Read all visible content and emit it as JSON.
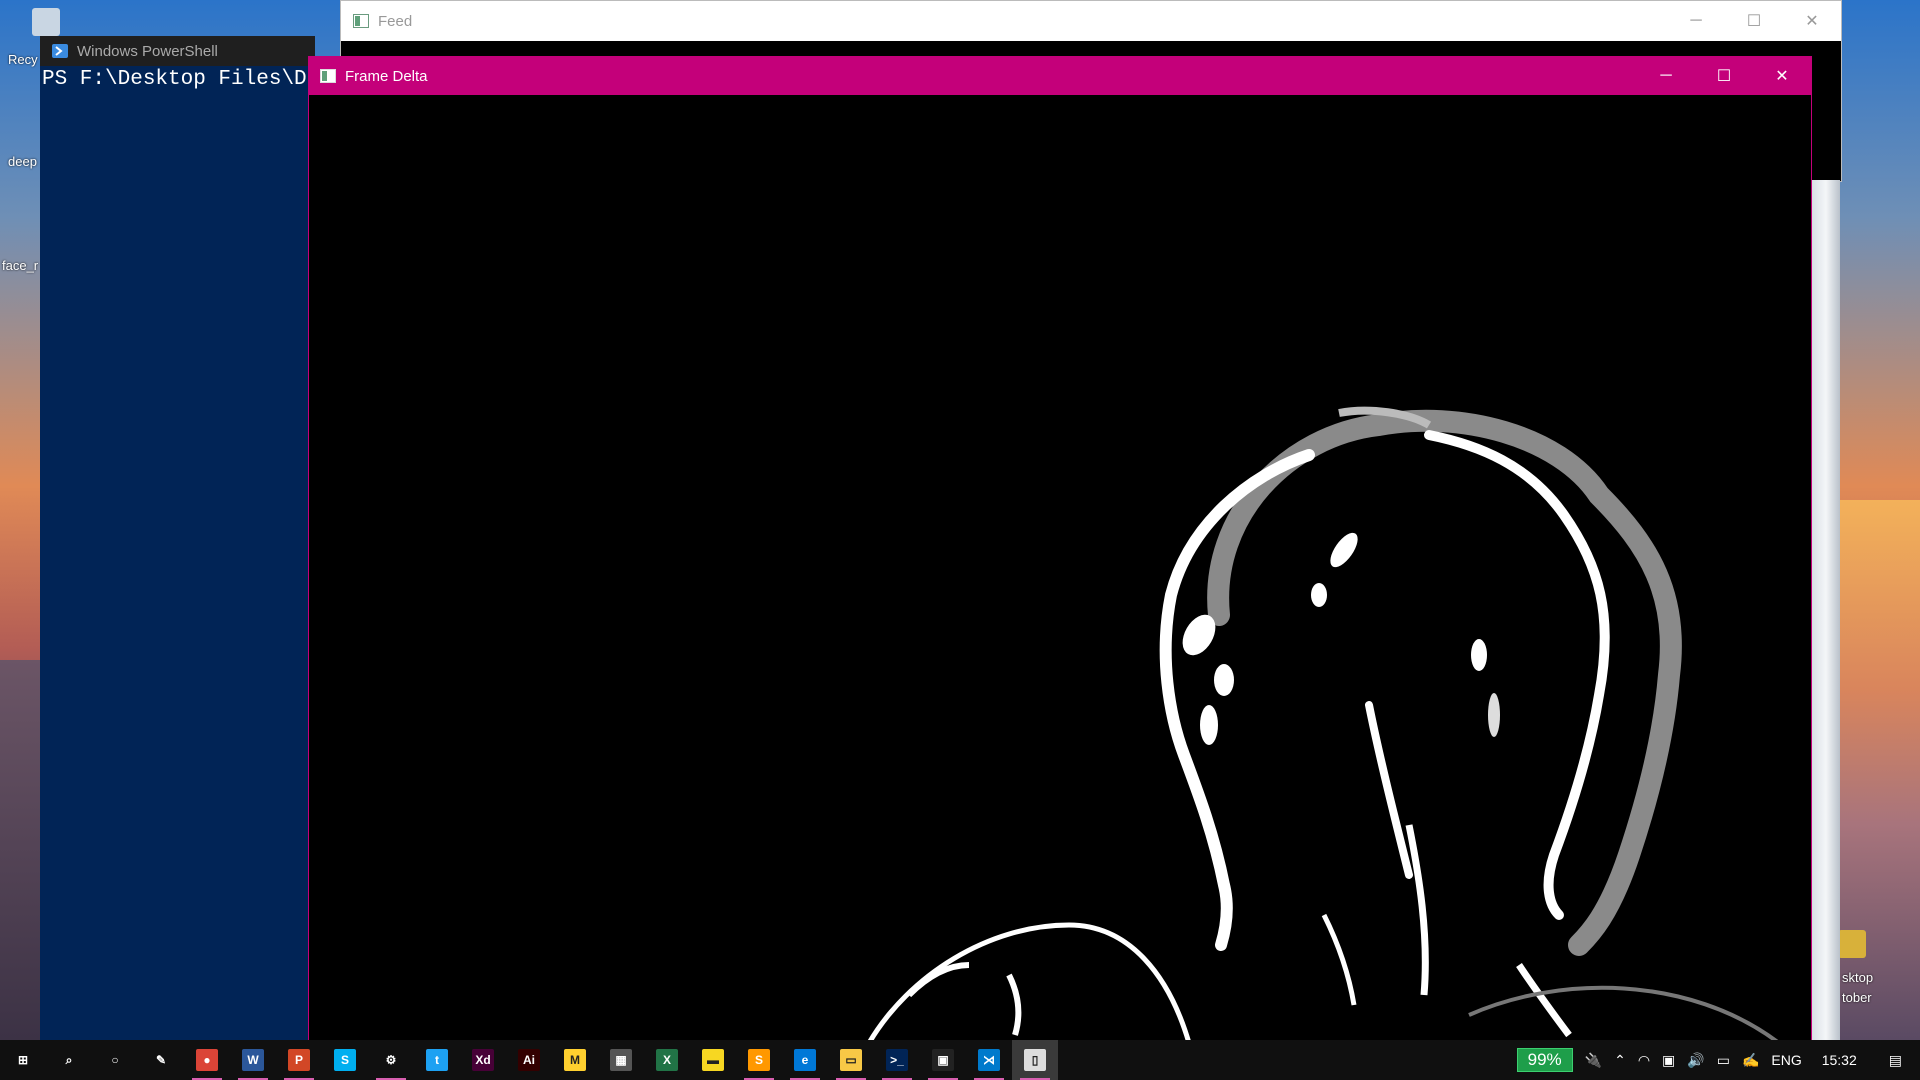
{
  "desktop": {
    "icons_left": [
      "Recy",
      "deep",
      "face_r"
    ],
    "icon_right_label_1": "sktop",
    "icon_right_label_2": "tober"
  },
  "feed_window": {
    "title": "Feed",
    "minimize": "─",
    "maximize": "☐",
    "close": "✕"
  },
  "powershell_window": {
    "title": "Windows PowerShell",
    "console_line": "PS F:\\Desktop Files\\Dra"
  },
  "frame_delta_window": {
    "title": "Frame Delta",
    "minimize": "─",
    "maximize": "☐",
    "close": "✕",
    "accent_color": "#c4007a"
  },
  "taskbar": {
    "apps": [
      {
        "name": "start",
        "icon": "windows-icon",
        "glyph": "⊞",
        "color": "#101010"
      },
      {
        "name": "search",
        "icon": "search-icon",
        "glyph": "⌕",
        "color": "#101010"
      },
      {
        "name": "cortana",
        "icon": "cortana-icon",
        "glyph": "○",
        "color": "#101010"
      },
      {
        "name": "pen",
        "icon": "pen-icon",
        "glyph": "✎",
        "color": "#101010"
      },
      {
        "name": "chrome",
        "icon": "chrome-icon",
        "glyph": "●",
        "color": "#db4437"
      },
      {
        "name": "word",
        "icon": "word-icon",
        "glyph": "W",
        "color": "#2b579a"
      },
      {
        "name": "powerpoint",
        "icon": "powerpoint-icon",
        "glyph": "P",
        "color": "#d24726"
      },
      {
        "name": "skype",
        "icon": "skype-icon",
        "glyph": "S",
        "color": "#00aff0"
      },
      {
        "name": "settings",
        "icon": "gear-icon",
        "glyph": "⚙",
        "color": "#101010"
      },
      {
        "name": "twitter",
        "icon": "twitter-icon",
        "glyph": "t",
        "color": "#1da1f2"
      },
      {
        "name": "adobe-xd",
        "icon": "xd-icon",
        "glyph": "Xd",
        "color": "#470137"
      },
      {
        "name": "illustrator",
        "icon": "illustrator-icon",
        "glyph": "Ai",
        "color": "#330000"
      },
      {
        "name": "miro",
        "icon": "miro-icon",
        "glyph": "M",
        "color": "#ffd02f"
      },
      {
        "name": "calculator",
        "icon": "calculator-icon",
        "glyph": "▦",
        "color": "#555555"
      },
      {
        "name": "excel",
        "icon": "excel-icon",
        "glyph": "X",
        "color": "#217346"
      },
      {
        "name": "sticky-notes",
        "icon": "sticky-notes-icon",
        "glyph": "▬",
        "color": "#f7d722"
      },
      {
        "name": "sublime",
        "icon": "sublime-icon",
        "glyph": "S",
        "color": "#ff9800"
      },
      {
        "name": "edge",
        "icon": "edge-icon",
        "glyph": "e",
        "color": "#0078d7"
      },
      {
        "name": "file-explorer",
        "icon": "folder-icon",
        "glyph": "▭",
        "color": "#f8c846"
      },
      {
        "name": "powershell",
        "icon": "powershell-icon",
        "glyph": ">_",
        "color": "#012456"
      },
      {
        "name": "terminal",
        "icon": "terminal-icon",
        "glyph": "▣",
        "color": "#222222"
      },
      {
        "name": "vscode",
        "icon": "vscode-icon",
        "glyph": "⋊",
        "color": "#007acc"
      },
      {
        "name": "document",
        "icon": "document-icon",
        "glyph": "▯",
        "color": "#dddddd"
      }
    ],
    "tray": {
      "battery_percent": "99%",
      "language": "ENG",
      "time": "15:32"
    }
  }
}
